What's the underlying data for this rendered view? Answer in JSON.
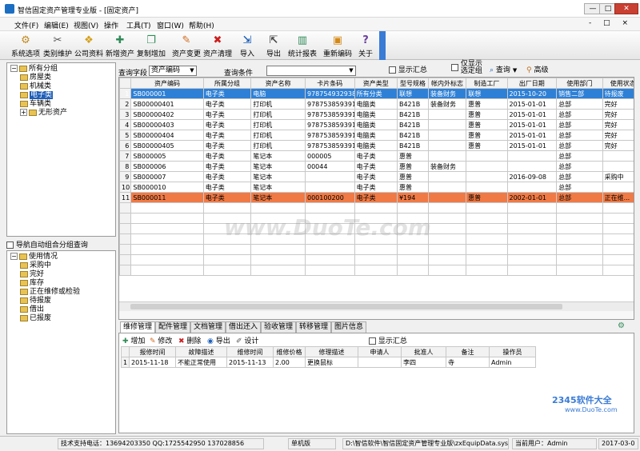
{
  "window": {
    "title": "智信固定资产管理专业版 - [固定资产]",
    "btn_min": "—",
    "btn_max": "□",
    "btn_close": "✕"
  },
  "menu": {
    "items": [
      "文件(F)",
      "编辑(E)",
      "视图(V)",
      "操作",
      "工具(T)",
      "窗口(W)",
      "帮助(H)"
    ],
    "mdi": "- □ ×"
  },
  "toolbar": {
    "items": [
      {
        "label": "系统选项",
        "icon": "gear-icon",
        "glyph": "⚙",
        "color": "#c08a20"
      },
      {
        "label": "类别维护",
        "icon": "tools-icon",
        "glyph": "✂",
        "color": "#555555"
      },
      {
        "label": "公司资料",
        "icon": "company-icon",
        "glyph": "❖",
        "color": "#d4a017"
      },
      {
        "label": "新增资产",
        "icon": "add-user-icon",
        "glyph": "✚",
        "color": "#2e8b57"
      },
      {
        "label": "复制增加",
        "icon": "copy-add-icon",
        "glyph": "❐",
        "color": "#2e8b57"
      },
      {
        "label": "资产变更",
        "icon": "pencil-icon",
        "glyph": "✎",
        "color": "#d2691e"
      },
      {
        "label": "资产清理",
        "icon": "delete-icon",
        "glyph": "✖",
        "color": "#cc1f1f"
      },
      {
        "label": "导入",
        "icon": "import-icon",
        "glyph": "⇲",
        "color": "#1f5fb8"
      },
      {
        "label": "导出",
        "icon": "export-icon",
        "glyph": "⇱",
        "color": "#444444"
      },
      {
        "label": "统计报表",
        "icon": "chart-icon",
        "glyph": "▥",
        "color": "#2e8b57"
      },
      {
        "label": "重新编码",
        "icon": "recode-icon",
        "glyph": "▣",
        "color": "#d48a17"
      },
      {
        "label": "关于",
        "icon": "help-icon",
        "glyph": "?",
        "color": "#6b3fa0"
      }
    ]
  },
  "left_tree": {
    "root": "所有分组",
    "children": [
      "房屋类",
      "机械类",
      "电子类",
      "车辆类",
      "无形资产"
    ],
    "selected": "电子类"
  },
  "auto_group": {
    "checkbox_label": "导航自动组合分组查询",
    "root": "使用情况",
    "children": [
      "采购中",
      "完好",
      "库存",
      "正在维修或检验",
      "待报废",
      "借出",
      "已报废"
    ]
  },
  "filter": {
    "field_label": "查询字段",
    "field_value": "资产编码",
    "cond_label": "查询条件",
    "cond_value": "",
    "show_total": "显示汇总",
    "only_show_selected": "仅显示\n选定组",
    "query": "查询",
    "advanced": "高级"
  },
  "grid": {
    "columns": [
      "资产编码",
      "所属分组",
      "资产名称",
      "卡片条码",
      "资产类型",
      "型号规格",
      "帐内外标志",
      "制造工厂",
      "出厂日期",
      "使用部门",
      "使用状态"
    ],
    "rows": [
      [
        "1",
        "SB000001",
        "电子类",
        "电脑",
        "9787549329380",
        "所有分类",
        "联想",
        "装备财务",
        "联想",
        "2015-10-20",
        "销售二部",
        "待报废"
      ],
      [
        "2",
        "SB00000401",
        "电子类",
        "打印机",
        "9787538593914",
        "电脑类",
        "B421B",
        "装备财务",
        "惠普",
        "2015-01-01",
        "总部",
        "完好"
      ],
      [
        "3",
        "SB00000402",
        "电子类",
        "打印机",
        "9787538593914",
        "电脑类",
        "B421B",
        "",
        "惠普",
        "2015-01-01",
        "总部",
        "完好"
      ],
      [
        "4",
        "SB00000403",
        "电子类",
        "打印机",
        "9787538593914",
        "电脑类",
        "B421B",
        "",
        "惠普",
        "2015-01-01",
        "总部",
        "完好"
      ],
      [
        "5",
        "SB00000404",
        "电子类",
        "打印机",
        "9787538593914",
        "电脑类",
        "B421B",
        "",
        "惠普",
        "2015-01-01",
        "总部",
        "完好"
      ],
      [
        "6",
        "SB00000405",
        "电子类",
        "打印机",
        "9787538593914",
        "电脑类",
        "B421B",
        "",
        "惠普",
        "2015-01-01",
        "总部",
        "完好"
      ],
      [
        "7",
        "SB000005",
        "电子类",
        "笔记本",
        "000005",
        "电子类",
        "惠普",
        "",
        "",
        "",
        "总部",
        ""
      ],
      [
        "8",
        "SB000006",
        "电子类",
        "笔记本",
        "00044",
        "电子类",
        "惠普",
        "装备财务",
        "",
        "",
        "总部",
        ""
      ],
      [
        "9",
        "SB000007",
        "电子类",
        "笔记本",
        "",
        "电子类",
        "惠普",
        "",
        "",
        "2016-09-08",
        "总部",
        "采购中"
      ],
      [
        "10",
        "SB000010",
        "电子类",
        "笔记本",
        "",
        "电子类",
        "惠普",
        "",
        "",
        "",
        "总部",
        ""
      ],
      [
        "11",
        "SB000011",
        "电子类",
        "笔记本",
        "000100200",
        "电子类",
        "¥194",
        "",
        "惠普",
        "2002-01-01",
        "总部",
        "正在维..."
      ]
    ]
  },
  "bottom": {
    "tabs": [
      "维修管理",
      "配件管理",
      "文档管理",
      "借出还入",
      "验收管理",
      "转移管理",
      "图片信息"
    ],
    "actions": [
      {
        "label": "增加",
        "icon": "add-icon"
      },
      {
        "label": "修改",
        "icon": "edit-icon"
      },
      {
        "label": "删除",
        "icon": "delete-icon"
      },
      {
        "label": "导出",
        "icon": "export-icon"
      },
      {
        "label": "设计",
        "icon": "design-icon"
      }
    ],
    "show_total": "显示汇总",
    "columns": [
      "报修时间",
      "故障描述",
      "维修时间",
      "维修价格",
      "修理描述",
      "申请人",
      "批准人",
      "备注",
      "操作员"
    ],
    "rows": [
      [
        "1",
        "2015-11-18",
        "不能正常使用",
        "2015-11-13",
        "2.00",
        "更换鼠标",
        "",
        "李四",
        "寺",
        "Admin"
      ]
    ]
  },
  "status": {
    "support": "技术支持电话：13694203350 QQ:1725542950 137028856",
    "edition": "单机版",
    "path": "D:\\智信软件\\智信固定资产管理专业版\\zxEquipData.sys",
    "user": "当前用户：Admin",
    "date": "2017-03-0"
  },
  "watermark": "www.DuoTe.com",
  "logo": {
    "brand": "2345软件大全",
    "url": "www.DuoTe.com"
  }
}
